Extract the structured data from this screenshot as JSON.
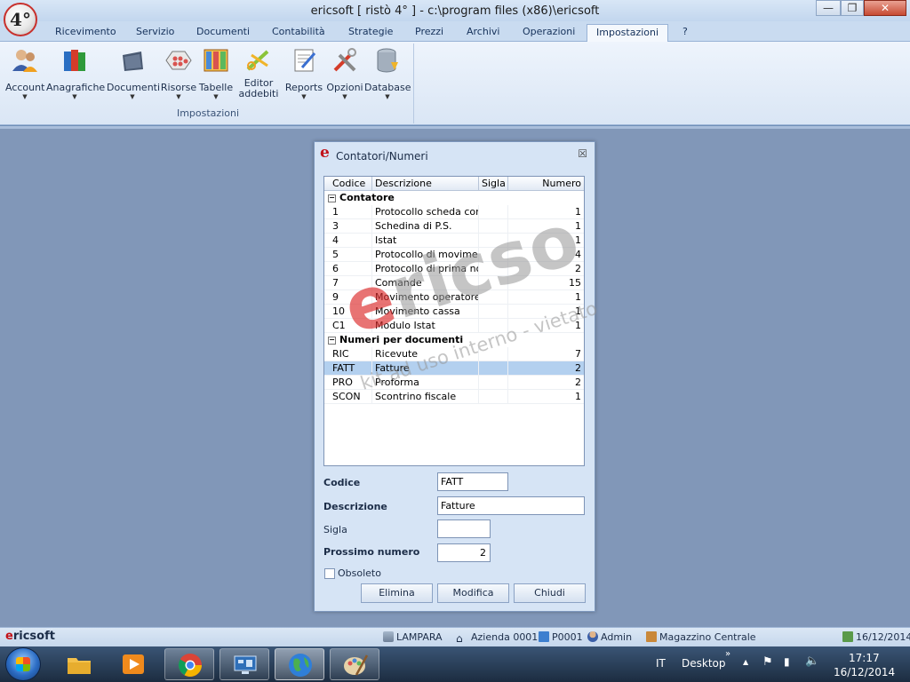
{
  "window": {
    "app_logo": "4°",
    "title": "ericsoft [ ristò 4° ] - c:\\program files (x86)\\ericsoft",
    "minimize_icon": "minimize-icon",
    "maximize_icon": "restore-icon",
    "close_icon": "close-icon"
  },
  "ribbon": {
    "tabs": [
      "Ricevimento",
      "Servizio",
      "Documenti",
      "Contabilità",
      "Strategie",
      "Prezzi",
      "Archivi",
      "Operazioni",
      "Impostazioni",
      "?"
    ],
    "active_tab": "Impostazioni",
    "buttons": [
      {
        "label": "Account",
        "icon": "users-icon"
      },
      {
        "label": "Anagrafiche",
        "icon": "books-icon"
      },
      {
        "label": "Documenti",
        "icon": "folder-icon"
      },
      {
        "label": "Risorse",
        "icon": "resources-icon"
      },
      {
        "label": "Tabelle",
        "icon": "table-icon"
      },
      {
        "label": "Editor addebiti",
        "icon": "editor-icon"
      },
      {
        "label": "Reports",
        "icon": "report-icon"
      },
      {
        "label": "Opzioni",
        "icon": "tools-icon"
      },
      {
        "label": "Database",
        "icon": "database-icon"
      }
    ],
    "group_label": "Impostazioni"
  },
  "dialog": {
    "logo": "e",
    "title": "Contatori/Numeri",
    "grid": {
      "columns": [
        "Codice",
        "Descrizione",
        "Sigla",
        "Numero"
      ],
      "groups": [
        {
          "name": "Contatore",
          "rows": [
            {
              "codice": "1",
              "descrizione": "Protocollo scheda conto",
              "sigla": "",
              "numero": "1"
            },
            {
              "codice": "3",
              "descrizione": "Schedina di P.S.",
              "sigla": "",
              "numero": "1"
            },
            {
              "codice": "4",
              "descrizione": "Istat",
              "sigla": "",
              "numero": "1"
            },
            {
              "codice": "5",
              "descrizione": "Protocollo di movimento",
              "sigla": "",
              "numero": "4"
            },
            {
              "codice": "6",
              "descrizione": "Protocollo di prima nota",
              "sigla": "",
              "numero": "2"
            },
            {
              "codice": "7",
              "descrizione": "Comande",
              "sigla": "",
              "numero": "15"
            },
            {
              "codice": "9",
              "descrizione": "Movimento operatore",
              "sigla": "",
              "numero": "1"
            },
            {
              "codice": "10",
              "descrizione": "Movimento cassa",
              "sigla": "",
              "numero": "1"
            },
            {
              "codice": "C1",
              "descrizione": "Modulo Istat",
              "sigla": "",
              "numero": "1"
            }
          ]
        },
        {
          "name": "Numeri per documenti",
          "rows": [
            {
              "codice": "RIC",
              "descrizione": "Ricevute",
              "sigla": "",
              "numero": "7"
            },
            {
              "codice": "FATT",
              "descrizione": "Fatture",
              "sigla": "",
              "numero": "2",
              "selected": true
            },
            {
              "codice": "PRO",
              "descrizione": "Proforma",
              "sigla": "",
              "numero": "2"
            },
            {
              "codice": "SCON",
              "descrizione": "Scontrino fiscale",
              "sigla": "",
              "numero": "1"
            }
          ]
        }
      ]
    },
    "watermark": {
      "big_prefix": "e",
      "big_rest": "ricso",
      "small": "kit ad uso interno - vietato"
    },
    "form": {
      "codice_label": "Codice",
      "codice_value": "FATT",
      "descrizione_label": "Descrizione",
      "descrizione_value": "Fatture",
      "sigla_label": "Sigla",
      "sigla_value": "",
      "prossimo_label": "Prossimo numero",
      "prossimo_value": "2",
      "obsoleto_label": "Obsoleto",
      "obsoleto_checked": false
    },
    "buttons": {
      "elimina": "Elimina",
      "modifica": "Modifica",
      "chiudi": "Chiudi"
    }
  },
  "statusbar": {
    "brand_e": "e",
    "brand_rest": "ricsoft",
    "database": "LAMPARA",
    "azienda": "Azienda 0001",
    "postazione": "P0001",
    "user": "Admin",
    "magazzino": "Magazzino Centrale",
    "date": "16/12/2014"
  },
  "taskbar": {
    "apps": [
      {
        "name": "explorer",
        "icon": "folder-icon",
        "open": false
      },
      {
        "name": "media-player",
        "icon": "media-player-icon",
        "open": false
      },
      {
        "name": "chrome",
        "icon": "chrome-icon",
        "open": true
      },
      {
        "name": "remote-desktop",
        "icon": "remote-desktop-icon",
        "open": true
      },
      {
        "name": "globe",
        "icon": "globe-icon",
        "open": true,
        "active": true
      },
      {
        "name": "paint",
        "icon": "paint-icon",
        "open": true
      }
    ],
    "language": "IT",
    "desktop_label": "Desktop",
    "time": "17:17",
    "date": "16/12/2014"
  },
  "colors": {
    "accent_red": "#c2131a",
    "selection": "#b3d0ef",
    "ribbon_bg": "#dae6f5"
  }
}
